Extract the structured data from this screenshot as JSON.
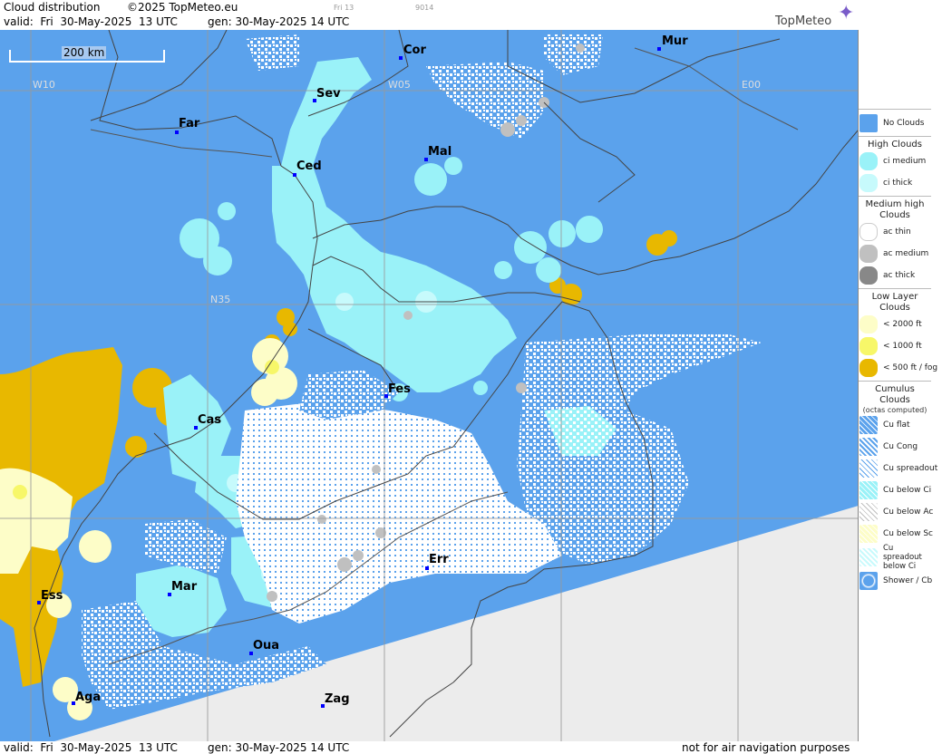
{
  "header": {
    "title": "Cloud distribution",
    "copyright": "©2025 TopMeteo.eu",
    "small_day": "Fri 13",
    "small_code": "9014",
    "valid_label": "valid:  Fri  30-May-2025  13 UTC",
    "gen_label": "gen: 30-May-2025 14 UTC",
    "logo": "TopMeteo"
  },
  "footer": {
    "valid_label": "valid:  Fri  30-May-2025  13 UTC",
    "gen_label": "gen: 30-May-2025 14 UTC",
    "disclaimer": "not for air navigation purposes"
  },
  "map": {
    "scale_label": "200 km",
    "grid_labels": {
      "w10": "W10",
      "w05": "W05",
      "e00": "E00",
      "n35": "N35"
    },
    "cities": [
      {
        "name": "Cor"
      },
      {
        "name": "Mur"
      },
      {
        "name": "Sev"
      },
      {
        "name": "Far"
      },
      {
        "name": "Mal"
      },
      {
        "name": "Ced"
      },
      {
        "name": "Fes"
      },
      {
        "name": "Cas"
      },
      {
        "name": "Err"
      },
      {
        "name": "Mar"
      },
      {
        "name": "Ess"
      },
      {
        "name": "Oua"
      },
      {
        "name": "Aga"
      },
      {
        "name": "Zag"
      }
    ]
  },
  "legend": {
    "no_clouds": "No Clouds",
    "high": {
      "title": "High Clouds",
      "items": [
        "ci medium",
        "ci thick"
      ]
    },
    "medium": {
      "title": "Medium high Clouds",
      "items": [
        "ac thin",
        "ac medium",
        "ac thick"
      ]
    },
    "low": {
      "title": "Low Layer Clouds",
      "items": [
        "< 2000 ft",
        "< 1000 ft",
        "< 500 ft / fog"
      ]
    },
    "cumulus": {
      "title": "Cumulus Clouds",
      "subtitle": "(octas computed)",
      "items": [
        "Cu flat",
        "Cu Cong",
        "Cu spreadout",
        "Cu below Ci",
        "Cu below Ac",
        "Cu below Sc",
        "Cu spreadout below Ci",
        "Shower / Cb"
      ]
    }
  },
  "colors": {
    "no_clouds": "#5ba2ec",
    "ci_medium": "#9af2f8",
    "ci_thick": "#c7fafc",
    "ac_thin": "#ffffff",
    "ac_medium": "#c0c0c0",
    "ac_thick": "#888888",
    "low_2000": "#fdfdc8",
    "low_1000": "#f7f769",
    "low_500": "#e8b800",
    "nodata": "#ececec"
  }
}
